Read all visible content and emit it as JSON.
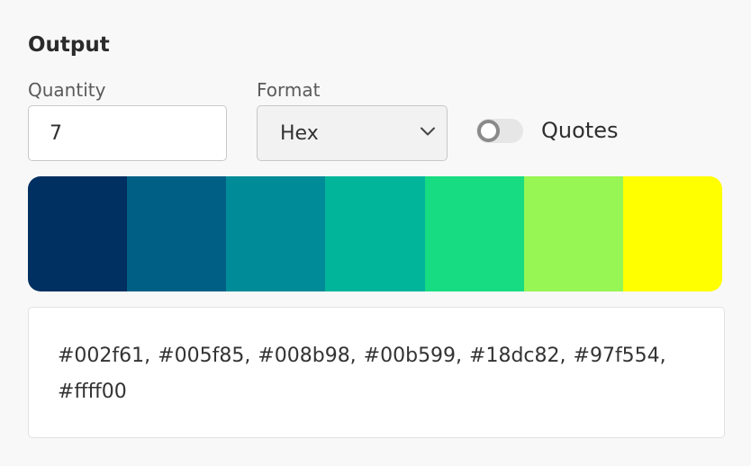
{
  "section": {
    "title": "Output"
  },
  "quantity": {
    "label": "Quantity",
    "value": "7"
  },
  "format": {
    "label": "Format",
    "selected": "Hex"
  },
  "quotes": {
    "label": "Quotes",
    "enabled": false
  },
  "palette": {
    "colors": [
      "#002f61",
      "#005f85",
      "#008b98",
      "#00b599",
      "#18dc82",
      "#97f554",
      "#ffff00"
    ]
  },
  "output": {
    "text": "#002f61, #005f85, #008b98, #00b599, #18dc82, #97f554, #ffff00"
  }
}
